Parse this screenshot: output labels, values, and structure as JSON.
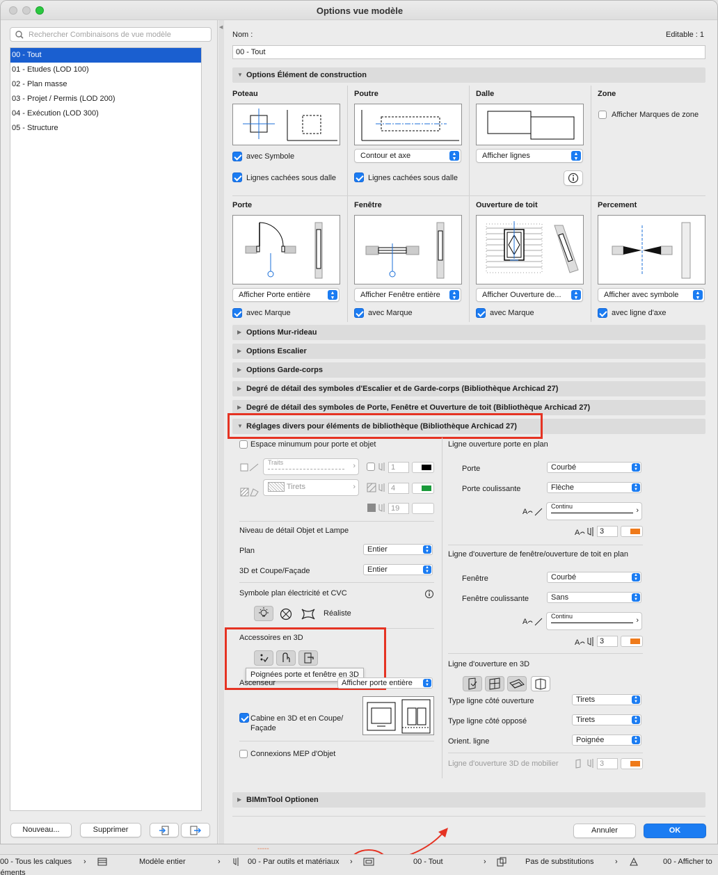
{
  "window": {
    "title": "Options vue modèle"
  },
  "left": {
    "search_placeholder": "Rechercher Combinaisons de vue modèle",
    "items": [
      "00 - Tout",
      "01 - Etudes (LOD 100)",
      "02 - Plan masse",
      "03 - Projet / Permis (LOD 200)",
      "04 - Exécution (LOD 300)",
      "05 - Structure"
    ],
    "selected_index": 0,
    "new_button": "Nouveau...",
    "delete_button": "Supprimer"
  },
  "header": {
    "name_label": "Nom :",
    "editable": "Editable : 1",
    "name_value": "00 - Tout"
  },
  "construction": {
    "title": "Options Élément de construction",
    "poteau": {
      "title": "Poteau",
      "check1": "avec Symbole",
      "check2": "Lignes cachées sous dalle"
    },
    "poutre": {
      "title": "Poutre",
      "select": "Contour et axe",
      "check": "Lignes cachées sous dalle"
    },
    "dalle": {
      "title": "Dalle",
      "select": "Afficher lignes"
    },
    "zone": {
      "title": "Zone",
      "check": "Afficher Marques de zone"
    },
    "porte": {
      "title": "Porte",
      "select": "Afficher Porte entière",
      "check": "avec Marque"
    },
    "fenetre": {
      "title": "Fenêtre",
      "select": "Afficher Fenêtre entière",
      "check": "avec Marque"
    },
    "ouverture": {
      "title": "Ouverture de toit",
      "select": "Afficher Ouverture de...",
      "check": "avec Marque"
    },
    "percement": {
      "title": "Percement",
      "select": "Afficher avec symbole",
      "check": "avec ligne d'axe"
    }
  },
  "sections": [
    "Options Mur-rideau",
    "Options Escalier",
    "Options Garde-corps",
    "Degré de détail des symboles d'Escalier et de Garde-corps (Bibliothèque Archicad 27)",
    "Degré de détail des symboles de Porte, Fenêtre et Ouverture de toit (Bibliothèque Archicad 27)",
    "Réglages divers pour éléments de bibliothèque (Bibliothèque Archicad 27)"
  ],
  "divers": {
    "espace": "Espace minumum pour porte et objet",
    "traits": "Traits",
    "tirets": "Tirets",
    "pen1": "1",
    "pen2": "4",
    "pen3": "19",
    "niveau": "Niveau de détail Objet et Lampe",
    "plan_label": "Plan",
    "plan_value": "Entier",
    "coupe_label": "3D et Coupe/Façade",
    "coupe_value": "Entier",
    "symbole": "Symbole plan électricité et CVC",
    "realiste": "Réaliste",
    "accessoires": "Accessoires en 3D",
    "tooltip": "Poignées porte et fenêtre en 3D",
    "ascenseur": "Ascenseur",
    "ascenseur_value": "Afficher porte entière",
    "cabine": "Cabine en 3D et en Coupe/ Façade",
    "mep": "Connexions MEP d'Objet"
  },
  "ouverture_plan": {
    "title": "Ligne ouverture porte en plan",
    "porte_label": "Porte",
    "porte_value": "Courbé",
    "coul_label": "Porte coulissante",
    "coul_value": "Flèche",
    "line": "Continu",
    "pen": "3"
  },
  "ouverture_fen": {
    "title": "Ligne d'ouverture de fenêtre/ouverture de toit en plan",
    "fen_label": "Fenêtre",
    "fen_value": "Courbé",
    "coul_label": "Fenêtre coulissante",
    "coul_value": "Sans",
    "line": "Continu",
    "pen": "3"
  },
  "ouverture_3d": {
    "title": "Ligne d'ouverture en 3D",
    "type1_label": "Type ligne côté ouverture",
    "type1_value": "Tirets",
    "type2_label": "Type ligne côté opposé",
    "type2_value": "Tirets",
    "orient_label": "Orient. ligne",
    "orient_value": "Poignée",
    "mobilier": "Ligne d'ouverture 3D de mobilier",
    "pen": "3"
  },
  "bimm": "BIMmTool Optionen",
  "footer": {
    "cancel": "Annuler",
    "ok": "OK"
  },
  "statusbar": {
    "layers": "00 - Tous les calques",
    "model": "Modèle entier",
    "pens": "00 - Par outils et matériaux",
    "view": "00 - Tout",
    "subst": "Pas de substitutions",
    "show": "00 - Afficher to",
    "second_line": "éléments",
    "dashes": "-----"
  },
  "colors": {
    "accent": "#1b7cf2",
    "selection": "#1a5fd0",
    "highlight": "#e53323",
    "pen_black": "#000000",
    "pen_green": "#1a9a3a",
    "pen_orange": "#ef7a1a"
  }
}
